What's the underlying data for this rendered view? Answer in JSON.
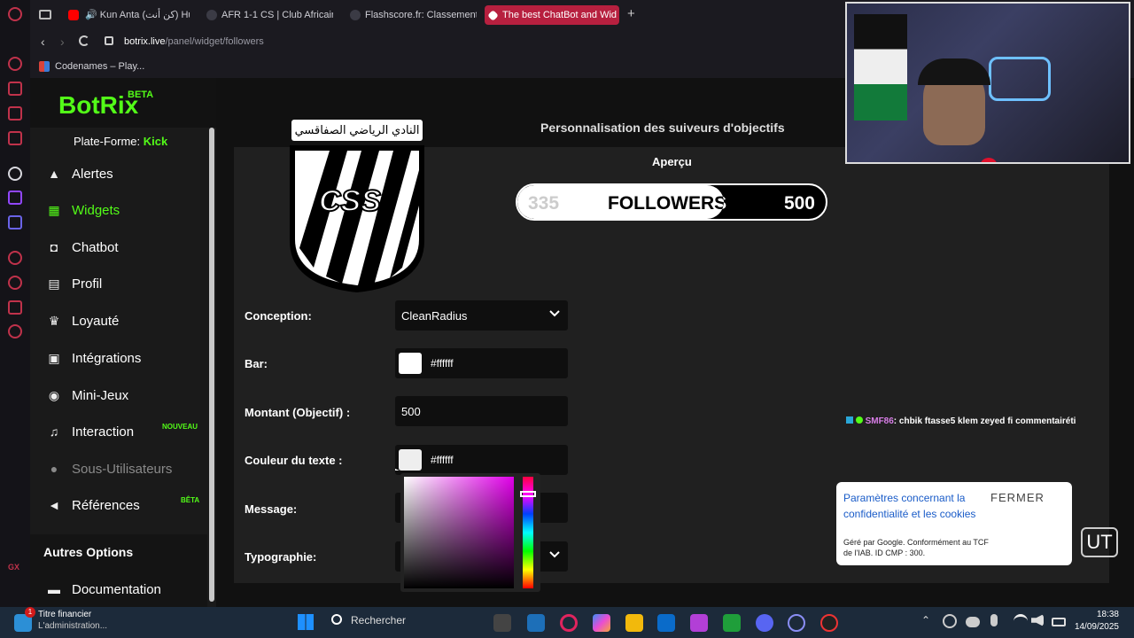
{
  "browser": {
    "tabs": [
      {
        "label": "Kun Anta (كن أنت) Hum",
        "active": false
      },
      {
        "label": "AFR 1-1 CS | Club Africain",
        "active": false
      },
      {
        "label": "Flashscore.fr: Classement",
        "active": false
      },
      {
        "label": "The best ChatBot and Wid",
        "active": true
      }
    ],
    "new_tab": "+",
    "url_host": "botrix.live",
    "url_path": "/panel/widget/followers",
    "bookmark": "Codenames – Play..."
  },
  "sidebar": {
    "brand": "BotRix",
    "brand_badge": "BETA",
    "platform_label": "Plate-Forme:",
    "platform_value": "Kick",
    "items": [
      {
        "label": "Alertes",
        "icon": "warning-icon"
      },
      {
        "label": "Widgets",
        "icon": "grid-icon"
      },
      {
        "label": "Chatbot",
        "icon": "robot-icon"
      },
      {
        "label": "Profil",
        "icon": "id-card-icon"
      },
      {
        "label": "Loyauté",
        "icon": "trophy-icon"
      },
      {
        "label": "Intégrations",
        "icon": "plug-icon"
      },
      {
        "label": "Mini-Jeux",
        "icon": "gamepad-icon"
      },
      {
        "label": "Interaction",
        "icon": "music-icon",
        "badge": "NOUVEAU"
      },
      {
        "label": "Sous-Utilisateurs",
        "icon": "users-icon"
      },
      {
        "label": "Références",
        "icon": "megaphone-icon",
        "badge": "BÊTA"
      }
    ],
    "other_options_heading": "Autres Options",
    "other_items": [
      {
        "label": "Documentation",
        "icon": "book-icon"
      }
    ]
  },
  "main": {
    "section_title": "Personnalisation des suiveurs d'objectifs",
    "preview_label": "Aperçu",
    "preview": {
      "current": "335",
      "label": "FOLLOWERS",
      "goal": "500",
      "progress_fraction": 0.67
    },
    "crest_text": "النادي الرياضي الصفاقسي",
    "crest_letters": "CSS",
    "form": {
      "design_label": "Conception:",
      "design_value": "CleanRadius",
      "bar_label": "Bar:",
      "bar_value": "#ffffff",
      "goal_label": "Montant (Objectif) :",
      "goal_value": "500",
      "text_color_label": "Couleur du texte :",
      "text_color_value": "#ffffff",
      "message_label": "Message:",
      "font_label": "Typographie:"
    }
  },
  "overlay": {
    "chat_user": "SMF86",
    "chat_message": ": chbik ftasse5 klem zeyed fi commentairéti",
    "cookie_text": "Paramètres concernant la confidentialité et les cookies",
    "cookie_close": "FERMER",
    "cookie_footer": "Géré par Google. Conformément au TCF de l'IAB. ID CMP : 300."
  },
  "taskbar": {
    "news_title": "Titre financier",
    "news_sub": "L'administration...",
    "news_badge": "1",
    "search_placeholder": "Rechercher",
    "time": "18:38",
    "date": "14/09/2025"
  },
  "colors": {
    "accent_green": "#53fc18",
    "opera_red": "#c0324b",
    "active_tab": "#b7203f"
  }
}
